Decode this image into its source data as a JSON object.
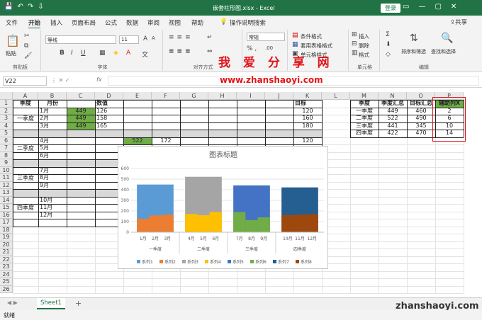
{
  "titlebar": {
    "filename": "嵌套柱形图.xlsx  -  Excel",
    "login": "登录",
    "quick_access": "💾↶↷⇩",
    "window_controls": "▭—▢✕"
  },
  "tabs": [
    "文件",
    "开始",
    "插入",
    "页面布局",
    "公式",
    "数据",
    "审阅",
    "视图",
    "帮助",
    "操作说明搜索"
  ],
  "share": "共享",
  "ribbon": {
    "clipboard": {
      "label": "剪贴板",
      "paste": "粘贴"
    },
    "font": {
      "label": "字体",
      "name": "等线",
      "size": "11"
    },
    "align": {
      "label": "对齐方式"
    },
    "number": {
      "format": "常规"
    },
    "styles": {
      "cond": "条件格式",
      "table": "套用表格格式",
      "cell": "单元格样式"
    },
    "cells": {
      "label": "单元格",
      "insert": "插入",
      "delete": "删除",
      "format": "格式"
    },
    "edit": {
      "label": "编辑",
      "sort": "排序和筛选",
      "find": "查找和选择"
    }
  },
  "watermark": {
    "title": "我 爱 分 享 网",
    "url": "www.zhanshaoyi.com"
  },
  "namebox": "V22",
  "fx": "fx",
  "columns": [
    "A",
    "B",
    "C",
    "D",
    "E",
    "F",
    "G",
    "H",
    "I",
    "J",
    "K",
    "L",
    "M",
    "N",
    "O",
    "P"
  ],
  "rows": [
    "1",
    "2",
    "3",
    "4",
    "5",
    "6",
    "7",
    "8",
    "9",
    "10",
    "11",
    "12",
    "13",
    "14",
    "15",
    "16",
    "17",
    "18",
    "19",
    "20",
    "21",
    "22",
    "23",
    "24",
    "25",
    "26"
  ],
  "left_table": {
    "headers": {
      "season": "季度",
      "month": "月份",
      "value": "数值",
      "target": "目标"
    },
    "quarters": [
      "一季度",
      "二季度",
      "三季度",
      "四季度"
    ],
    "months": [
      "1月",
      "2月",
      "3月",
      "4月",
      "5月",
      "6月",
      "7月",
      "8月",
      "9月",
      "10月",
      "11月",
      "12月"
    ],
    "c_values": [
      "449",
      "449",
      "449"
    ],
    "d_values": [
      "126",
      "158",
      "165"
    ],
    "targets": [
      "120",
      "160",
      "180",
      "120"
    ],
    "e6": "522",
    "f6": "172"
  },
  "right_table": {
    "headers": [
      "季度",
      "季度汇总",
      "目标汇总",
      "辅助列X"
    ],
    "rows": [
      [
        "一季度",
        "449",
        "460",
        "2"
      ],
      [
        "二季度",
        "522",
        "490",
        "6"
      ],
      [
        "三季度",
        "441",
        "345",
        "10"
      ],
      [
        "四季度",
        "422",
        "470",
        "14"
      ]
    ]
  },
  "chart_data": {
    "type": "bar",
    "title": "图表标题",
    "ylim": [
      0,
      600
    ],
    "yticks": [
      "0",
      "100",
      "200",
      "300",
      "400",
      "500",
      "600"
    ],
    "months": [
      "1月",
      "2月",
      "3月",
      "4月",
      "5月",
      "6月",
      "7月",
      "8月",
      "9月",
      "10月",
      "11月",
      "12月"
    ],
    "groups": [
      "一季度",
      "二季度",
      "三季度",
      "四季度"
    ],
    "quarter_totals": [
      449,
      522,
      441,
      422
    ],
    "month_values": [
      126,
      158,
      165,
      172,
      160,
      190,
      190,
      115,
      140,
      160,
      165,
      170
    ],
    "legend": [
      "系列1",
      "系列2",
      "系列3",
      "系列4",
      "系列5",
      "系列6",
      "系列7",
      "系列8"
    ],
    "colors": [
      "#5b9bd5",
      "#ed7d31",
      "#a5a5a5",
      "#ffc000",
      "#4472c4",
      "#70ad47",
      "#255e91",
      "#9e480e"
    ]
  },
  "sheet": {
    "name": "Sheet1",
    "add": "+"
  },
  "status": {
    "ready": "就绪"
  },
  "site": "zhanshaoyi.com"
}
